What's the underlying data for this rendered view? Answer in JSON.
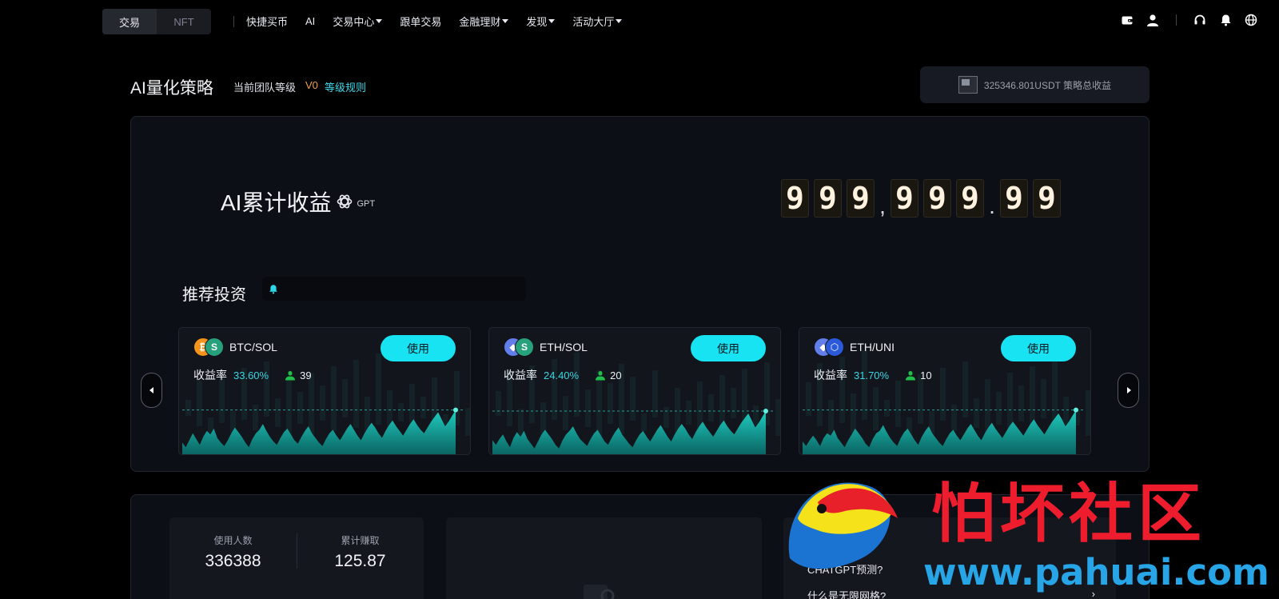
{
  "nav": {
    "segments": [
      "交易",
      "NFT"
    ],
    "links": [
      {
        "label": "快捷买币",
        "dropdown": false
      },
      {
        "label": "AI",
        "dropdown": false
      },
      {
        "label": "交易中心",
        "dropdown": true
      },
      {
        "label": "跟单交易",
        "dropdown": false
      },
      {
        "label": "金融理财",
        "dropdown": true
      },
      {
        "label": "发现",
        "dropdown": true
      },
      {
        "label": "活动大厅",
        "dropdown": true
      }
    ],
    "right_icons": [
      "wallet-icon",
      "user-icon",
      "headset-icon",
      "bell-icon",
      "globe-icon"
    ]
  },
  "header": {
    "title": "AI量化策略",
    "team_label": "当前团队等级",
    "team_level": "V0",
    "rules_link": "等级规则",
    "total_text": "325346.801USDT 策略总收益"
  },
  "hero": {
    "title": "AI累计收益",
    "gpt_label": "GPT",
    "counter": [
      "9",
      "9",
      "9",
      ",",
      "9",
      "9",
      "9",
      ".",
      "9",
      "9"
    ]
  },
  "recommend": {
    "title": "推荐投资",
    "cards": [
      {
        "pair": "BTC/SOL",
        "coin1": {
          "symbol": "₿",
          "color": "#f7931a"
        },
        "coin2": {
          "symbol": "S",
          "color": "#26a17b"
        },
        "use_label": "使用",
        "yield_label": "收益率",
        "yield": "33.60%",
        "users": "39",
        "spark": [
          38,
          42,
          36,
          30,
          35,
          40,
          33,
          28,
          31,
          26,
          34,
          38,
          41,
          36,
          30,
          25,
          29,
          33,
          38,
          42,
          35,
          30,
          27,
          22,
          28,
          33,
          37,
          40,
          34,
          29,
          26,
          31,
          36,
          39,
          33,
          28,
          24,
          30,
          34,
          38,
          41,
          35,
          30,
          27,
          32,
          36,
          31,
          26,
          22,
          27,
          32,
          36,
          30,
          25,
          21,
          25,
          30,
          34,
          28,
          23,
          19,
          24,
          28,
          32,
          27,
          22,
          18,
          23,
          27,
          30,
          25,
          20,
          16,
          12,
          18,
          24,
          20,
          15,
          10
        ]
      },
      {
        "pair": "ETH/SOL",
        "coin1": {
          "symbol": "◆",
          "color": "#627eea"
        },
        "coin2": {
          "symbol": "S",
          "color": "#26a17b"
        },
        "use_label": "使用",
        "yield_label": "收益率",
        "yield": "24.40%",
        "users": "20",
        "spark": [
          36,
          40,
          35,
          31,
          37,
          42,
          34,
          29,
          33,
          28,
          35,
          39,
          43,
          37,
          31,
          27,
          31,
          35,
          40,
          43,
          36,
          31,
          28,
          24,
          30,
          35,
          38,
          41,
          35,
          30,
          27,
          32,
          37,
          40,
          34,
          29,
          25,
          31,
          35,
          39,
          42,
          36,
          31,
          28,
          33,
          37,
          32,
          27,
          23,
          28,
          33,
          37,
          31,
          26,
          22,
          26,
          31,
          35,
          29,
          24,
          20,
          25,
          29,
          33,
          28,
          23,
          19,
          24,
          28,
          31,
          26,
          21,
          17,
          13,
          19,
          25,
          21,
          16,
          11
        ]
      },
      {
        "pair": "ETH/UNI",
        "coin1": {
          "symbol": "◆",
          "color": "#627eea"
        },
        "coin2": {
          "symbol": "⬡",
          "color": "#2a5ada"
        },
        "use_label": "使用",
        "yield_label": "收益率",
        "yield": "31.70%",
        "users": "10",
        "spark": [
          37,
          41,
          36,
          32,
          36,
          41,
          34,
          30,
          32,
          27,
          34,
          38,
          42,
          36,
          31,
          26,
          30,
          34,
          39,
          42,
          35,
          30,
          28,
          23,
          29,
          34,
          38,
          41,
          34,
          29,
          26,
          31,
          36,
          40,
          33,
          28,
          24,
          30,
          34,
          38,
          41,
          35,
          30,
          27,
          32,
          36,
          31,
          26,
          22,
          27,
          32,
          36,
          30,
          25,
          21,
          26,
          30,
          34,
          29,
          24,
          20,
          24,
          28,
          32,
          27,
          22,
          18,
          23,
          27,
          31,
          26,
          21,
          17,
          13,
          18,
          24,
          20,
          15,
          10
        ]
      }
    ]
  },
  "stats": {
    "users_label": "使用人数",
    "users_value": "336388",
    "earn_label": "累计赚取",
    "earn_value": "125.87"
  },
  "faq": {
    "q1": "CHATGPT预测?",
    "q2": "什么是无限网格?"
  },
  "watermark": {
    "text": "怕坏社区",
    "url": "www.pahuai.com"
  }
}
